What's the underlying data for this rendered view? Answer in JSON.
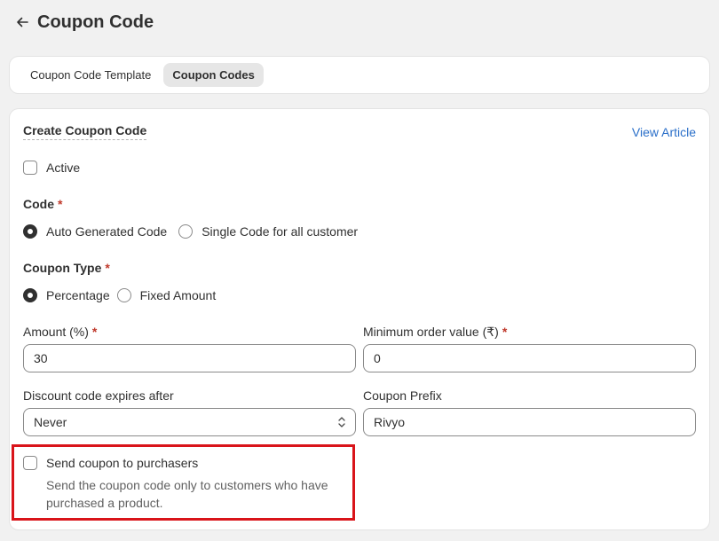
{
  "header": {
    "title": "Coupon Code"
  },
  "tabs": [
    {
      "label": "Coupon Code Template"
    },
    {
      "label": "Coupon Codes"
    }
  ],
  "card": {
    "title": "Create Coupon Code",
    "view_article": "View Article"
  },
  "active": {
    "label": "Active",
    "checked": false
  },
  "code": {
    "label": "Code",
    "required": "*",
    "options": [
      "Auto Generated Code",
      "Single Code for all customer"
    ],
    "selected": "Auto Generated Code"
  },
  "coupon_type": {
    "label": "Coupon Type",
    "required": "*",
    "options": [
      "Percentage",
      "Fixed Amount"
    ],
    "selected": "Percentage"
  },
  "amount": {
    "label": "Amount (%)",
    "required": "*",
    "value": "30"
  },
  "min_order": {
    "label": "Minimum order value (₹)",
    "required": "*",
    "value": "0"
  },
  "expires": {
    "label": "Discount code expires after",
    "value": "Never"
  },
  "prefix": {
    "label": "Coupon Prefix",
    "value": "Rivyo"
  },
  "send_coupon": {
    "label": "Send coupon to purchasers",
    "help": "Send the coupon code only to customers who have purchased a product.",
    "checked": false
  },
  "colors": {
    "link": "#2a6fc9",
    "highlight": "#d9141a",
    "required": "#c0392b"
  }
}
